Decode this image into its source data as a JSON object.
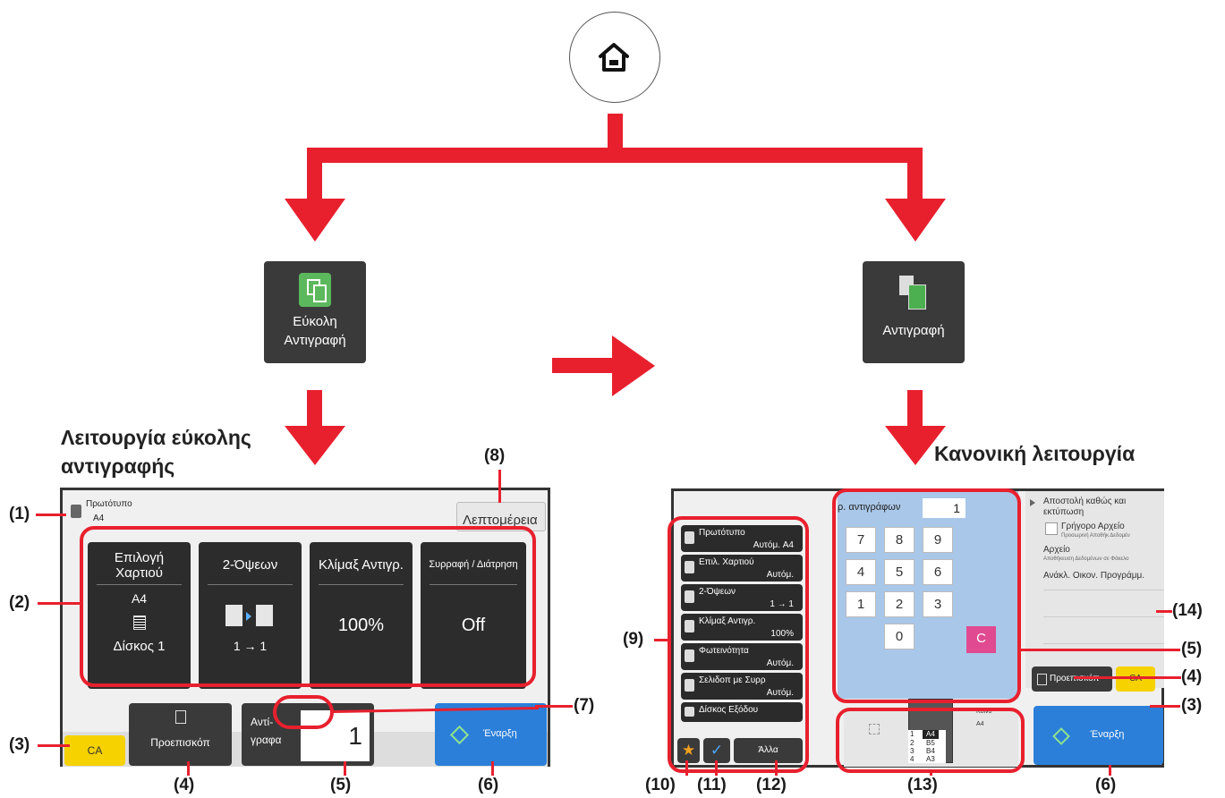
{
  "home_icon": "home-icon",
  "tiles": {
    "easy_copy": {
      "line1": "Εύκολη",
      "line2": "Αντιγραφή"
    },
    "copy": {
      "label": "Αντιγραφή"
    }
  },
  "headings": {
    "easy_line1": "Λειτουργία εύκολης",
    "easy_line2": "αντιγραφής",
    "normal": "Κανονική λειτουργία"
  },
  "easy_screen": {
    "original_label": "Πρωτότυπο",
    "original_size": "A4",
    "details_button": "Λεπτομέρεια",
    "functions": [
      {
        "title_line1": "Επιλογή",
        "title_line2": "Χαρτιού",
        "value_top": "A4",
        "value_bottom": "Δίσκος 1"
      },
      {
        "title_line1": "2-Όψεων",
        "value_bottom": "1 → 1"
      },
      {
        "title_line1": "Κλίμαξ Αντιγρ.",
        "value_main": "100%"
      },
      {
        "title_line1": "Συρραφή / Διάτρηση",
        "value_main": "Off"
      }
    ],
    "ca": "CA",
    "preview": "Προεπισκόπ",
    "copies_label_1": "Αντί-",
    "copies_label_2": "γραφα",
    "copies_value": "1",
    "start": "Έναρξη"
  },
  "normal_screen": {
    "copies_label": "ρ. αντιγράφων",
    "copies_value": "1",
    "keypad": [
      "7",
      "8",
      "9",
      "4",
      "5",
      "6",
      "1",
      "2",
      "3",
      "0"
    ],
    "clear_key": "C",
    "side_items": [
      {
        "title": "Πρωτότυπο",
        "value": "Αυτόμ.   A4"
      },
      {
        "title": "Επιλ. Χαρτιού",
        "value": "Αυτόμ."
      },
      {
        "title": "2-Όψεων",
        "value": "1 → 1"
      },
      {
        "title": "Κλίμαξ Αντιγρ.",
        "value": "100%"
      },
      {
        "title": "Φωτεινότητα",
        "value": "Αυτόμ."
      },
      {
        "title": "Σελιδοπ με Συρρ",
        "value": "Αυτόμ."
      },
      {
        "title": "Δίσκος Εξόδου",
        "value": ""
      }
    ],
    "other_button": "Άλλα",
    "actions": {
      "send_print": "Αποστολή καθώς και εκτύπωση",
      "quick_file": "Γρήγορο Αρχείο",
      "quick_file_sub": "Προσωρινή Αποθήκ Δεδομέν",
      "file": "Αρχείο",
      "file_sub": "Αποθήκευση Δεδομένων σε Φάκελο",
      "recall": "Ανάκλ. Οικον. Προγράμμ."
    },
    "tray_label_plain": "Κοινο",
    "tray_label_size": "A4",
    "trays": [
      {
        "num": "1",
        "size": "A4"
      },
      {
        "num": "2",
        "size": "B5"
      },
      {
        "num": "3",
        "size": "B4"
      },
      {
        "num": "4",
        "size": "A3"
      }
    ],
    "preview": "Προεπισκόπ",
    "ca": "CA",
    "start": "Έναρξη"
  },
  "callouts": {
    "c1": "(1)",
    "c2": "(2)",
    "c3": "(3)",
    "c4": "(4)",
    "c5": "(5)",
    "c6": "(6)",
    "c7": "(7)",
    "c8": "(8)",
    "c9": "(9)",
    "c10": "(10)",
    "c11": "(11)",
    "c12": "(12)",
    "c13": "(13)",
    "c14": "(14)"
  },
  "colors": {
    "accent_red": "#e8202e",
    "start_blue": "#2b7fd9",
    "ca_yellow": "#f5d200",
    "easy_tile_green": "#5cb85c"
  }
}
